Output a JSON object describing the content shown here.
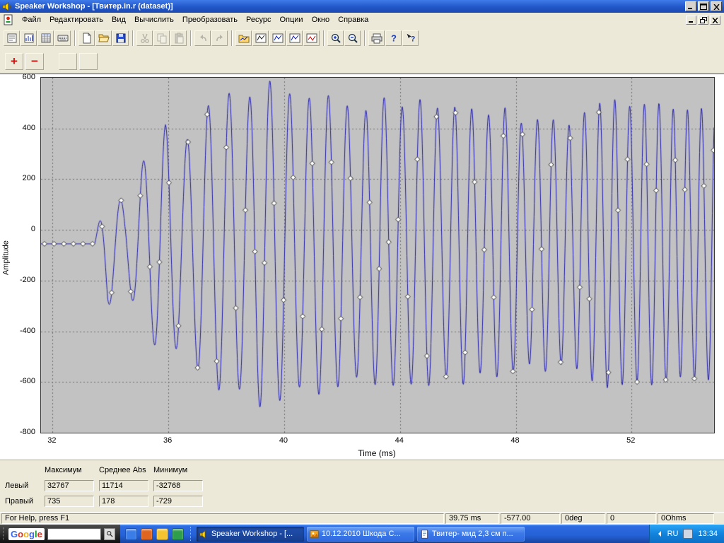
{
  "window": {
    "title": "Speaker Workshop - [Твитер.in.r (dataset)]",
    "buttons": [
      "minimize",
      "maximize",
      "close"
    ]
  },
  "mdi": {
    "buttons": [
      "minimize",
      "restore",
      "close"
    ]
  },
  "menu": {
    "items": [
      "Файл",
      "Редактировать",
      "Вид",
      "Вычислить",
      "Преобразовать",
      "Ресурс",
      "Опции",
      "Окно",
      "Справка"
    ]
  },
  "toolbar": {
    "groups": [
      [
        {
          "name": "view-notes",
          "icon": "notes"
        },
        {
          "name": "view-chart",
          "icon": "chart-view"
        },
        {
          "name": "view-datasheet",
          "icon": "datasheet"
        },
        {
          "name": "view-properties",
          "icon": "grid"
        }
      ],
      [
        {
          "name": "new",
          "icon": "new"
        },
        {
          "name": "open",
          "icon": "open"
        },
        {
          "name": "save",
          "icon": "save"
        }
      ],
      [
        {
          "name": "cut",
          "icon": "cut",
          "disabled": true
        },
        {
          "name": "copy",
          "icon": "copy",
          "disabled": true
        },
        {
          "name": "paste",
          "icon": "paste",
          "disabled": true
        }
      ],
      [
        {
          "name": "undo",
          "icon": "undo",
          "disabled": true
        },
        {
          "name": "redo",
          "icon": "redo",
          "disabled": true
        }
      ],
      [
        {
          "name": "import-chart",
          "icon": "folder-chart"
        },
        {
          "name": "chart-a",
          "icon": "chart1"
        },
        {
          "name": "chart-b",
          "icon": "chart2"
        },
        {
          "name": "chart-c",
          "icon": "chart3"
        },
        {
          "name": "chart-d",
          "icon": "chart-red"
        }
      ],
      [
        {
          "name": "zoom-in",
          "icon": "zoom-in"
        },
        {
          "name": "zoom-out",
          "icon": "zoom-out"
        }
      ],
      [
        {
          "name": "print",
          "icon": "print"
        },
        {
          "name": "help",
          "icon": "help"
        },
        {
          "name": "context-help",
          "icon": "context-help"
        }
      ]
    ]
  },
  "toolbar2": {
    "buttons": [
      {
        "name": "add-marker",
        "label": "+",
        "color": "#cc1111"
      },
      {
        "name": "remove-marker",
        "label": "−",
        "color": "#cc1111"
      },
      {
        "name": "blank-1",
        "label": "",
        "disabled": true
      },
      {
        "name": "blank-2",
        "label": "",
        "disabled": true
      }
    ]
  },
  "chart_data": {
    "type": "line",
    "title": "",
    "xlabel": "Time (ms)",
    "ylabel": "Amplitude",
    "xlim": [
      31.6,
      54.85
    ],
    "ylim": [
      -800,
      600
    ],
    "xticks": [
      32,
      36,
      40,
      44,
      48,
      52
    ],
    "yticks": [
      600,
      400,
      200,
      0,
      -200,
      -400,
      -600,
      -800
    ],
    "grid": true,
    "legend": false,
    "plot_bg": "#c2c2c2",
    "line_color": "#1a16b0",
    "marker": {
      "shape": "diamond",
      "fill": "#ffffff",
      "stroke": "#303030"
    },
    "waveform": {
      "offset": -55,
      "t0": 33.45,
      "f0_khz": 1.25,
      "f1_khz": 2.1,
      "sample_step": 0.01,
      "marker_step": 0.33,
      "envelope": [
        [
          33.45,
          0
        ],
        [
          33.9,
          250
        ],
        [
          34.5,
          150
        ],
        [
          35.1,
          320
        ],
        [
          35.9,
          470
        ],
        [
          36.5,
          380
        ],
        [
          37.2,
          530
        ],
        [
          38.0,
          600
        ],
        [
          38.7,
          560
        ],
        [
          39.25,
          660
        ],
        [
          39.9,
          615
        ],
        [
          40.6,
          560
        ],
        [
          41.3,
          600
        ],
        [
          42.0,
          555
        ],
        [
          42.7,
          515
        ],
        [
          43.4,
          580
        ],
        [
          44.1,
          540
        ],
        [
          44.8,
          575
        ],
        [
          45.5,
          520
        ],
        [
          46.2,
          555
        ],
        [
          46.9,
          500
        ],
        [
          47.6,
          540
        ],
        [
          48.3,
          465
        ],
        [
          49.0,
          505
        ],
        [
          49.8,
          465
        ],
        [
          50.6,
          540
        ],
        [
          51.3,
          575
        ],
        [
          52.0,
          540
        ],
        [
          52.8,
          560
        ],
        [
          53.6,
          525
        ],
        [
          54.85,
          540
        ]
      ]
    }
  },
  "stats": {
    "columns": [
      "Максимум",
      "Среднее Abs",
      "Минимум"
    ],
    "rows": [
      {
        "label": "Левый",
        "values": [
          "32767",
          "11714",
          "-32768"
        ]
      },
      {
        "label": "Правый",
        "values": [
          "735",
          "178",
          "-729"
        ]
      }
    ]
  },
  "statusbar": {
    "help": "For Help, press F1",
    "panels": [
      "39.75 ms",
      "-577.00",
      "0deg",
      "0",
      "0Ohms"
    ]
  },
  "taskbar": {
    "google_label": "Google",
    "quick_launch": [
      {
        "color": "#3b7de8"
      },
      {
        "color": "#e0661f"
      },
      {
        "color": "#f4c430"
      },
      {
        "color": "#2f9e4a"
      }
    ],
    "tasks": [
      {
        "label": "Speaker Workshop - [...",
        "icon": "speaker",
        "active": true
      },
      {
        "label": "10.12.2010 Шкода С...",
        "icon": "photo",
        "active": false
      },
      {
        "label": "Твитер- мид 2,3 см п...",
        "icon": "doc",
        "active": false
      }
    ],
    "tray": {
      "lang": "RU",
      "time": "13:34"
    }
  }
}
